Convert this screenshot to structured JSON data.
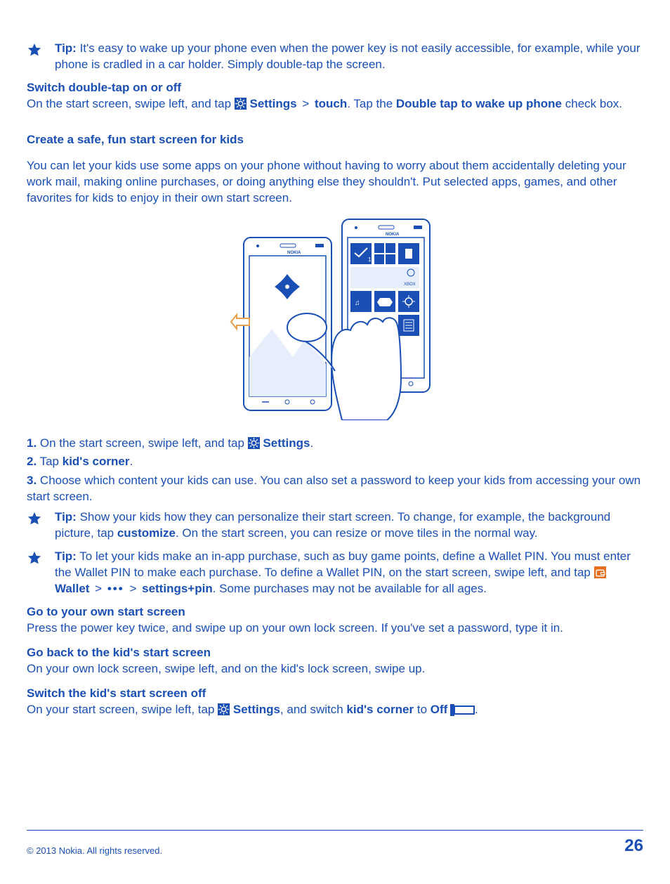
{
  "tip1": {
    "label": "Tip:",
    "text": " It's easy to wake up your phone even when the power key is not easily accessible, for example, while your phone is cradled in a car holder. Simply double-tap the screen."
  },
  "section1": {
    "heading": "Switch double-tap on or off",
    "text_a": "On the start screen, swipe left, and tap ",
    "settings_label": "Settings",
    "gt": ">",
    "touch_label": "touch",
    "text_b": ". Tap the ",
    "dtap_label": "Double tap to wake up phone",
    "text_c": " check box."
  },
  "section2": {
    "heading": "Create a safe, fun start screen for kids",
    "para": "You can let your kids use some apps on your phone without having to worry about them accidentally deleting your work mail, making online purchases, or doing anything else they shouldn't. Put selected apps, games, and other favorites for kids to enjoy in their own start screen."
  },
  "steps": {
    "s1_num": "1.",
    "s1_a": " On the start screen, swipe left, and tap ",
    "s1_settings": "Settings",
    "s1_end": ".",
    "s2_num": "2.",
    "s2_a": " Tap ",
    "s2_kc": "kid's corner",
    "s2_end": ".",
    "s3_num": "3.",
    "s3_a": " Choose which content your kids can use. You can also set a password to keep your kids from accessing your own start screen."
  },
  "tip2": {
    "label": "Tip:",
    "a": " Show your kids how they can personalize their start screen. To change, for example, the background picture, tap ",
    "customize": "customize",
    "b": ". On the start screen, you can resize or move tiles in the normal way."
  },
  "tip3": {
    "label": "Tip:",
    "a": " To let your kids make an in-app purchase, such as buy game points, define a Wallet PIN. You must enter the Wallet PIN to make each purchase. To define a Wallet PIN, on the start screen, swipe left, and tap ",
    "wallet": "Wallet",
    "gt": ">",
    "dots": "•••",
    "spin": "settings+pin",
    "b": ". Some purchases may not be available for all ages."
  },
  "section3": {
    "heading": "Go to your own start screen",
    "para": "Press the power key twice, and swipe up on your own lock screen. If you've set a password, type it in."
  },
  "section4": {
    "heading": "Go back to the kid's start screen",
    "para": "On your own lock screen, swipe left, and on the kid's lock screen, swipe up."
  },
  "section5": {
    "heading": "Switch the kid's start screen off",
    "a": "On your start screen, swipe left, tap ",
    "settings": "Settings",
    "b": ", and switch ",
    "kc": "kid's corner",
    "c": " to ",
    "off": "Off",
    "end": "."
  },
  "footer": {
    "copyright": "© 2013 Nokia. All rights reserved.",
    "page": "26"
  }
}
